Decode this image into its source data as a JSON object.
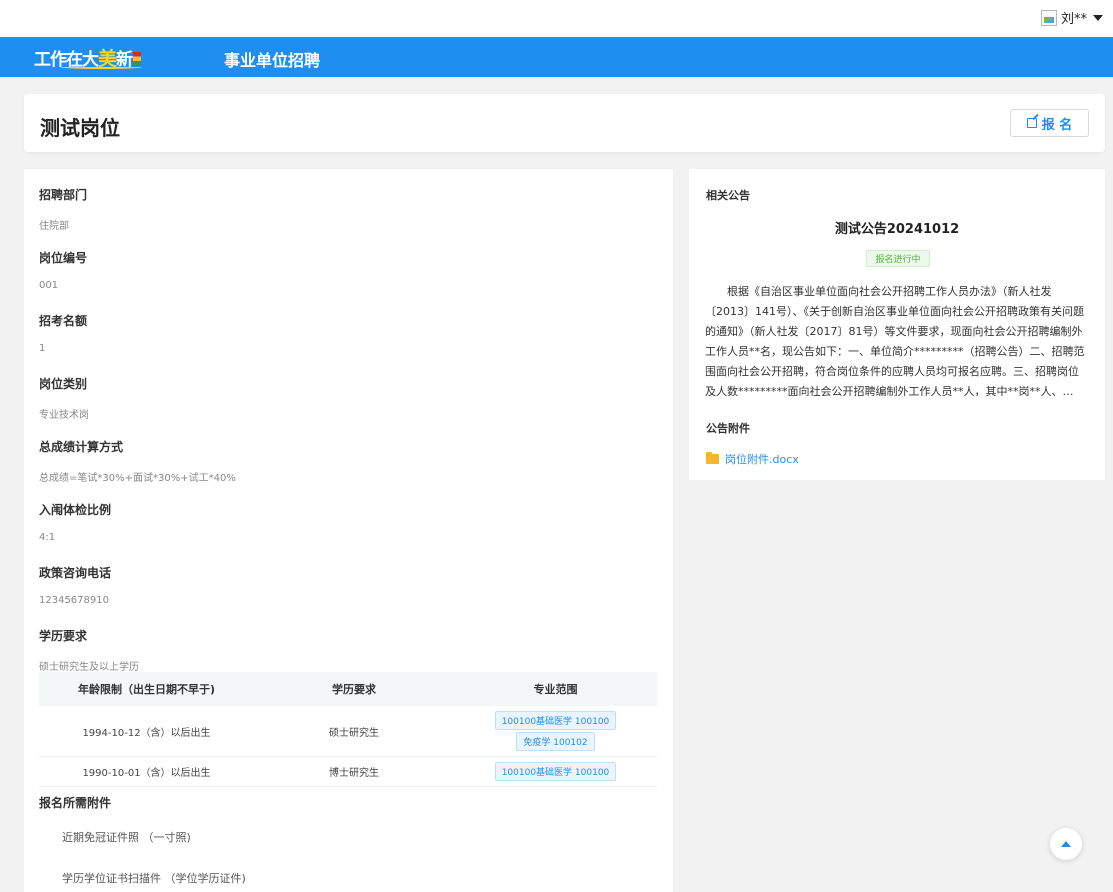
{
  "user": {
    "name": "刘**"
  },
  "nav": {
    "logo_part1": "工作在大",
    "logo_highlight": "美",
    "logo_part2": "新",
    "title": "事业单位招聘"
  },
  "header": {
    "title": "测试岗位",
    "signup_label": "报 名"
  },
  "job": {
    "fields": [
      {
        "label": "招聘部门",
        "value": "住院部"
      },
      {
        "label": "岗位编号",
        "value": "001"
      },
      {
        "label": "招考名额",
        "value": "1"
      },
      {
        "label": "岗位类别",
        "value": "专业技术岗"
      },
      {
        "label": "总成绩计算方式",
        "value": "总成绩=笔试*30%+面试*30%+试工*40%"
      },
      {
        "label": "入闱体检比例",
        "value": "4:1"
      },
      {
        "label": "政策咨询电话",
        "value": "12345678910"
      },
      {
        "label": "学历要求",
        "value": "硕士研究生及以上学历"
      }
    ],
    "table": {
      "headers": [
        "年龄限制（出生日期不早于)",
        "学历要求",
        "专业范围"
      ],
      "rows": [
        {
          "age": "1994-10-12（含）以后出生",
          "degree": "硕士研究生",
          "majors": [
            "100100基础医学 100100",
            "免疫学 100102"
          ]
        },
        {
          "age": "1990-10-01（含）以后出生",
          "degree": "博士研究生",
          "majors": [
            "100100基础医学 100100"
          ]
        }
      ]
    },
    "attachments_label": "报名所需附件",
    "attachments": [
      "近期免冠证件照 （一寸照)",
      "学历学位证书扫描件 （学位学历证件)"
    ]
  },
  "notice": {
    "section_label": "相关公告",
    "title": "测试公告20241012",
    "status": "报名进行中",
    "body": "根据《自治区事业单位面向社会公开招聘工作人员办法》（新人社发〔2013〕141号）、《关于创新自治区事业单位面向社会公开招聘政策有关问题的通知》（新人社发〔2017〕81号）等文件要求，现面向社会公开招聘编制外工作人员**名，现公告如下：一、单位简介*********（招聘公告）二、招聘范围面向社会公开招聘，符合岗位条件的应聘人员均可报名应聘。三、招聘岗位及人数*********面向社会公开招聘编制外工作人员**人，其中**岗**人、…",
    "attachments_label": "公告附件",
    "file_name": "岗位附件.docx"
  },
  "colors": {
    "primary": "#1e8ff0",
    "success": "#52b640",
    "logo_accent": "#ffd21f"
  }
}
